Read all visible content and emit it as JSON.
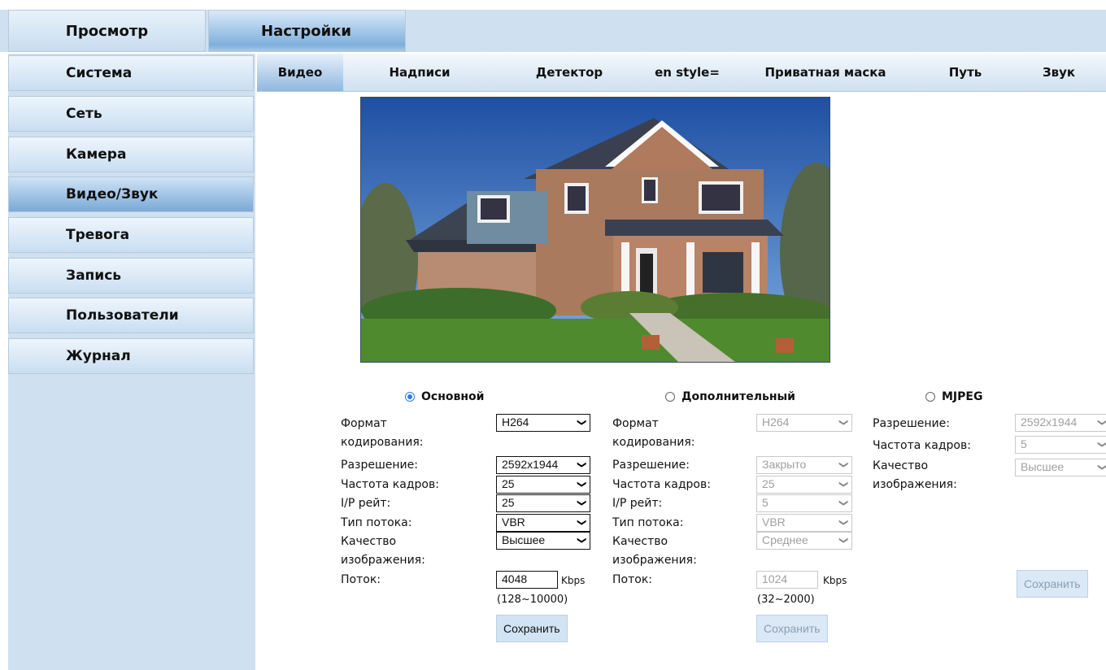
{
  "top_tabs": [
    "Просмотр",
    "Настройки"
  ],
  "sidebar": {
    "items": [
      {
        "label": "Система"
      },
      {
        "label": "Сеть"
      },
      {
        "label": "Камера"
      },
      {
        "label": "Видео/Звук",
        "active": true
      },
      {
        "label": "Тревога"
      },
      {
        "label": "Запись"
      },
      {
        "label": "Пользователи"
      },
      {
        "label": "Журнал"
      }
    ]
  },
  "sub_tabs": [
    "Видео",
    "Надписи",
    "Детектор",
    "en style=",
    "Приватная маска",
    "Путь",
    "Звук"
  ],
  "streams": {
    "main": {
      "title": "Основной",
      "selected": true,
      "labels": {
        "format_1": "Формат",
        "format_2": "кодирования:",
        "resolution": "Разрешение:",
        "fps": "Частота кадров:",
        "ip": "I/P рейт:",
        "type": "Тип потока:",
        "quality_1": "Качество",
        "quality_2": "изображения:",
        "bitrate": "Поток:"
      },
      "values": {
        "format": "H264",
        "resolution": "2592x1944",
        "fps": "25",
        "ip": "25",
        "type": "VBR",
        "quality": "Высшее",
        "bitrate": "4048"
      },
      "unit": "Kbps",
      "range": "(128~10000)",
      "save": "Сохранить"
    },
    "sub": {
      "title": "Дополнительный",
      "selected": false,
      "labels": {
        "format_1": "Формат",
        "format_2": "кодирования:",
        "resolution": "Разрешение:",
        "fps": "Частота кадров:",
        "ip": "I/P рейт:",
        "type": "Тип потока:",
        "quality_1": "Качество",
        "quality_2": "изображения:",
        "bitrate": "Поток:"
      },
      "values": {
        "format": "H264",
        "resolution": "Закрыто",
        "fps": "25",
        "ip": "5",
        "type": "VBR",
        "quality": "Среднее",
        "bitrate": "1024"
      },
      "unit": "Kbps",
      "range": "(32~2000)",
      "save": "Сохранить"
    },
    "mjpeg": {
      "title": "MJPEG",
      "selected": false,
      "labels": {
        "resolution": "Разрешение:",
        "fps": "Частота кадров:",
        "quality_1": "Качество",
        "quality_2": "изображения:"
      },
      "values": {
        "resolution": "2592x1944",
        "fps": "5",
        "quality": "Высшее"
      },
      "save": "Сохранить"
    }
  },
  "colors": {
    "header_bg": "#cfe0f0",
    "active_tab": "#7fb0dc",
    "radio_accent": "#2f7de1"
  }
}
